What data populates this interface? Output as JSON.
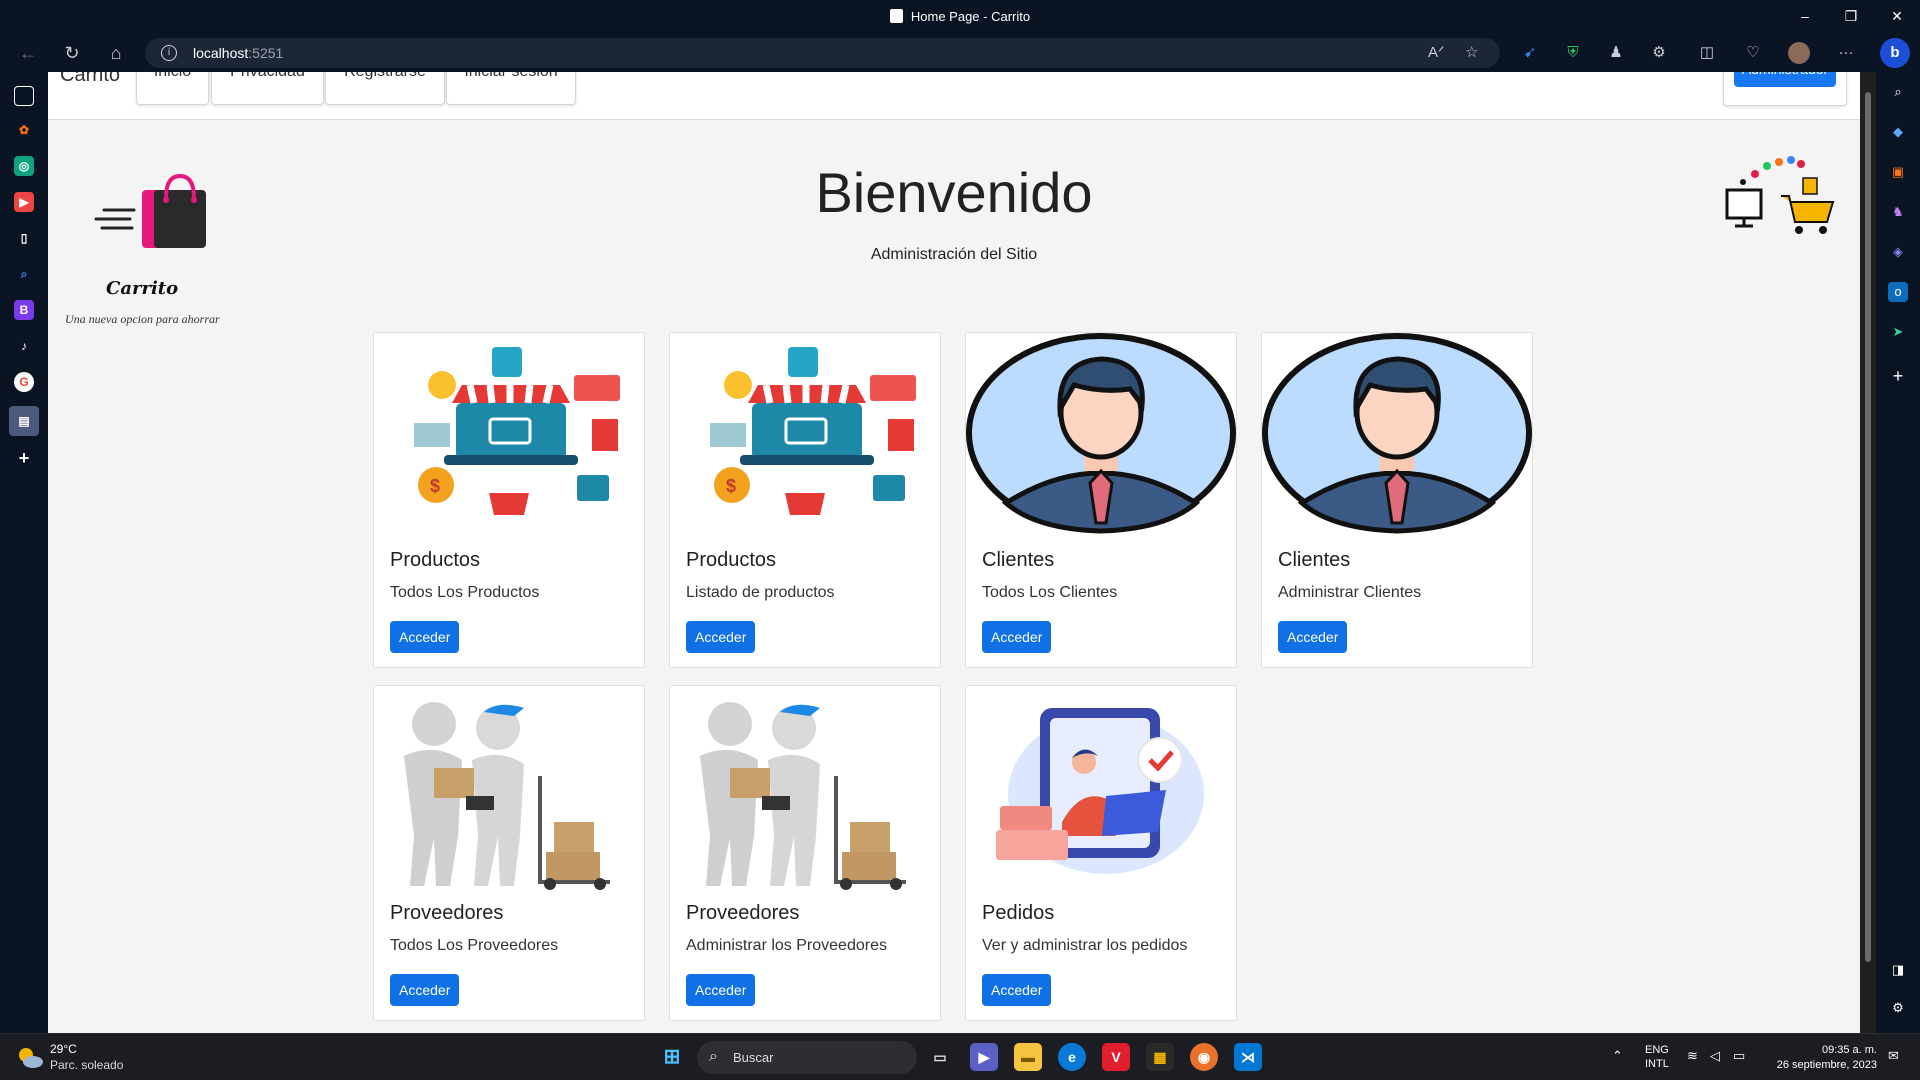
{
  "window": {
    "title": "Home Page - Carrito",
    "minimize": "–",
    "restore": "❐",
    "close": "✕"
  },
  "address": {
    "host": "localhost",
    "port": ":5251"
  },
  "site": {
    "brand": "Carrito",
    "nav": [
      "Inicio",
      "Privacidad",
      "Registrarse",
      "Iniciar sesion"
    ],
    "admin_button": "Administrador",
    "logo_word": "Carrito",
    "logo_tagline": "Una nueva opcion para ahorrar",
    "hero_title": "Bienvenido",
    "hero_subtitle": "Administración del Sitio"
  },
  "cards": [
    {
      "title": "Productos",
      "text": "Todos Los Productos",
      "button": "Acceder",
      "image": "shop-illustration"
    },
    {
      "title": "Productos",
      "text": "Listado de productos",
      "button": "Acceder",
      "image": "shop-illustration"
    },
    {
      "title": "Clientes",
      "text": "Todos Los Clientes",
      "button": "Acceder",
      "image": "businessman-avatar"
    },
    {
      "title": "Clientes",
      "text": "Administrar Clientes",
      "button": "Acceder",
      "image": "businessman-avatar"
    },
    {
      "title": "Proveedores",
      "text": "Todos Los Proveedores",
      "button": "Acceder",
      "image": "delivery-figures"
    },
    {
      "title": "Proveedores",
      "text": "Administrar los Proveedores",
      "button": "Acceder",
      "image": "delivery-figures"
    },
    {
      "title": "Pedidos",
      "text": "Ver y administrar los pedidos",
      "button": "Acceder",
      "image": "orders-illustration"
    }
  ],
  "taskbar": {
    "temperature": "29°C",
    "weather": "Parc. soleado",
    "search": "Buscar",
    "lang_1": "ENG",
    "lang_2": "INTL",
    "time": "09:35 a. m.",
    "date": "26 septiembre, 2023"
  },
  "colors": {
    "accent": "#1877f2",
    "chrome": "#0b1423",
    "page_bg": "#f4f4f4"
  }
}
